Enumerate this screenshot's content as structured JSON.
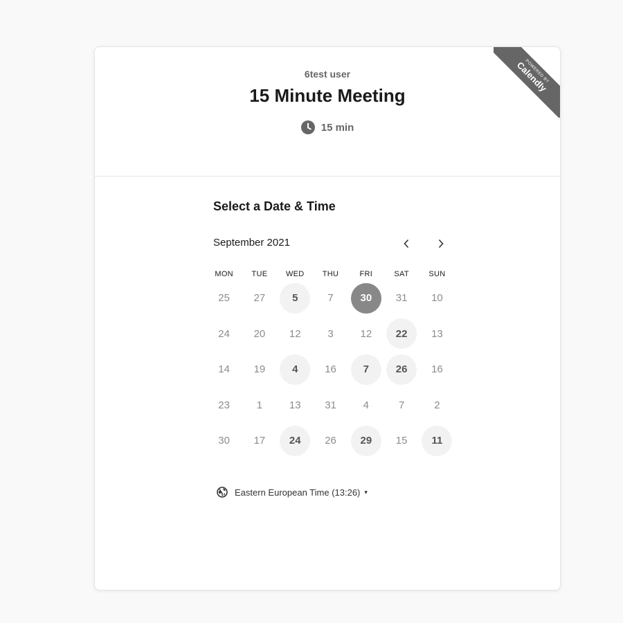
{
  "badge": {
    "small": "POWERED BY",
    "brand": "Calendly"
  },
  "header": {
    "host": "6test user",
    "title": "15 Minute Meeting",
    "duration": "15 min"
  },
  "calendar": {
    "section_title": "Select a Date & Time",
    "month_label": "September 2021",
    "prev_label": "previous-month",
    "next_label": "next-month",
    "weekdays": [
      "MON",
      "TUE",
      "WED",
      "THU",
      "FRI",
      "SAT",
      "SUN"
    ],
    "weeks": [
      [
        {
          "d": "25",
          "s": "none"
        },
        {
          "d": "27",
          "s": "none"
        },
        {
          "d": "5",
          "s": "available"
        },
        {
          "d": "7",
          "s": "none"
        },
        {
          "d": "30",
          "s": "selected"
        },
        {
          "d": "31",
          "s": "none"
        },
        {
          "d": "10",
          "s": "none"
        }
      ],
      [
        {
          "d": "24",
          "s": "none"
        },
        {
          "d": "20",
          "s": "none"
        },
        {
          "d": "12",
          "s": "none"
        },
        {
          "d": "3",
          "s": "none"
        },
        {
          "d": "12",
          "s": "none"
        },
        {
          "d": "22",
          "s": "available"
        },
        {
          "d": "13",
          "s": "none"
        }
      ],
      [
        {
          "d": "14",
          "s": "none"
        },
        {
          "d": "19",
          "s": "none"
        },
        {
          "d": "4",
          "s": "available"
        },
        {
          "d": "16",
          "s": "none"
        },
        {
          "d": "7",
          "s": "available"
        },
        {
          "d": "26",
          "s": "available"
        },
        {
          "d": "16",
          "s": "none"
        }
      ],
      [
        {
          "d": "23",
          "s": "none"
        },
        {
          "d": "1",
          "s": "none"
        },
        {
          "d": "13",
          "s": "none"
        },
        {
          "d": "31",
          "s": "none"
        },
        {
          "d": "4",
          "s": "none"
        },
        {
          "d": "7",
          "s": "none"
        },
        {
          "d": "2",
          "s": "none"
        }
      ],
      [
        {
          "d": "30",
          "s": "none"
        },
        {
          "d": "17",
          "s": "none"
        },
        {
          "d": "24",
          "s": "available"
        },
        {
          "d": "26",
          "s": "none"
        },
        {
          "d": "29",
          "s": "available"
        },
        {
          "d": "15",
          "s": "none"
        },
        {
          "d": "11",
          "s": "available"
        }
      ]
    ]
  },
  "timezone": {
    "label": "Eastern European Time (13:26)",
    "caret": "▾"
  },
  "colors": {
    "selected": "#888888",
    "available_bg": "#f2f2f2",
    "badge": "#666666"
  }
}
